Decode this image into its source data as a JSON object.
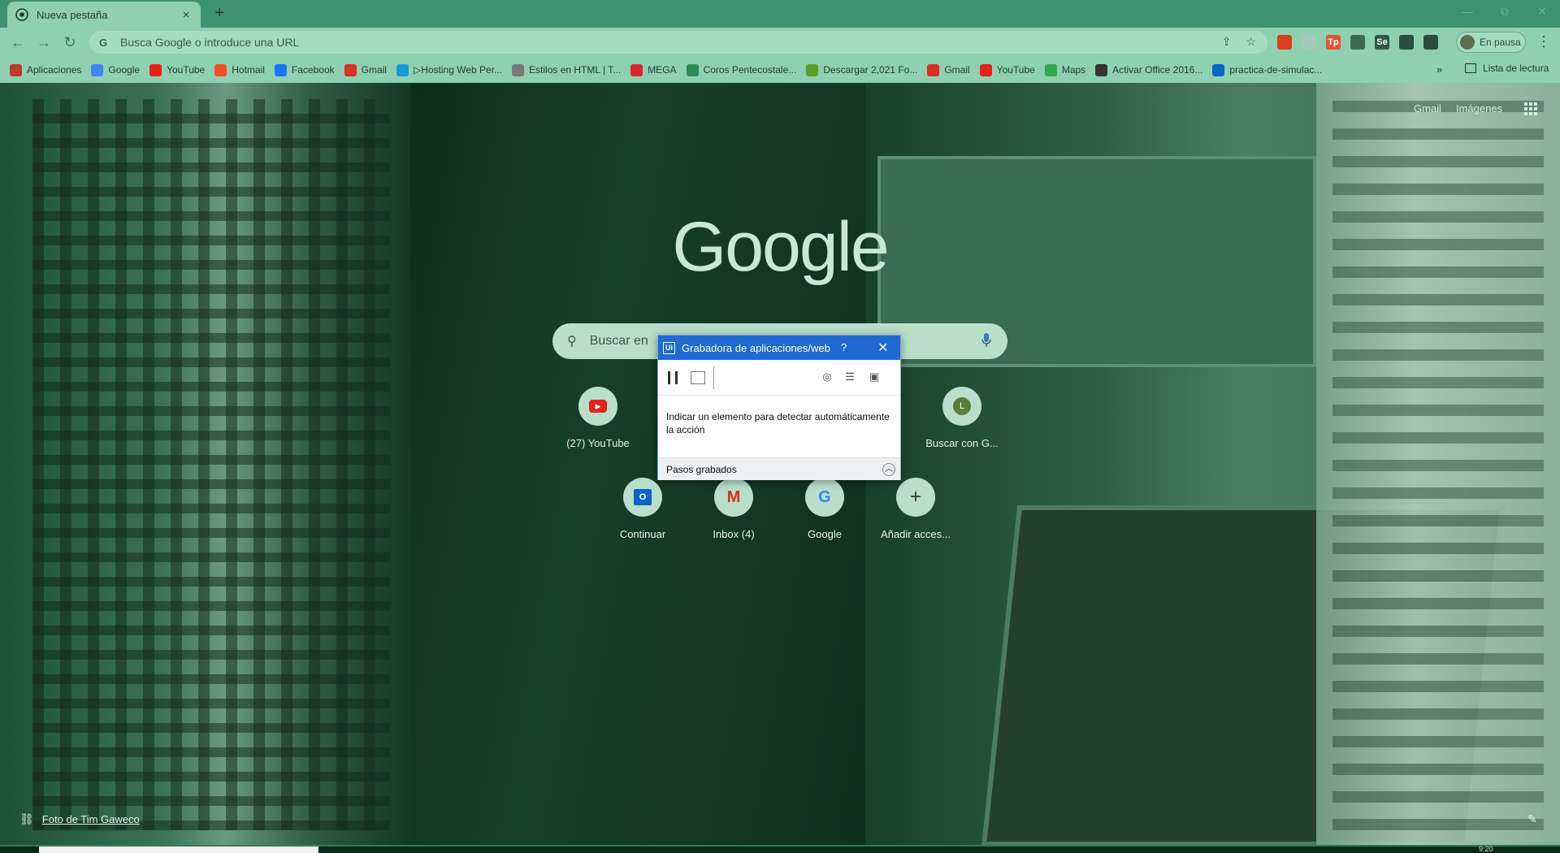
{
  "browser": {
    "tab_title": "Nueva pestaña",
    "tab_close": "×",
    "new_tab": "+",
    "window_controls": [
      "—",
      "⧉",
      "✕"
    ],
    "address_placeholder": "Busca Google o introduce una URL",
    "profile_label": "En pausa",
    "menu": "⋮"
  },
  "extensions": [
    {
      "label": "",
      "color": "#d8401f"
    },
    {
      "label": "",
      "color": "#a7c8b8"
    },
    {
      "label": "Tp",
      "color": "#e55332"
    },
    {
      "label": "",
      "color": "#3c6b53"
    },
    {
      "label": "Se",
      "color": "#2f5848"
    },
    {
      "label": "",
      "color": "#2b4d40"
    },
    {
      "label": "",
      "color": "#2b4d40"
    }
  ],
  "bookmarks": [
    {
      "label": "Aplicaciones",
      "icon": "apps-grid-icon",
      "color": "#c0392b"
    },
    {
      "label": "Google",
      "icon": "google-icon",
      "color": "#4285f4"
    },
    {
      "label": "YouTube",
      "icon": "youtube-icon",
      "color": "#e62117"
    },
    {
      "label": "Hotmail",
      "icon": "hotmail-icon",
      "color": "#f25022"
    },
    {
      "label": "Facebook",
      "icon": "facebook-icon",
      "color": "#1877f2"
    },
    {
      "label": "Gmail",
      "icon": "gmail-icon",
      "color": "#d93025"
    },
    {
      "label": "▷Hosting Web Per...",
      "icon": "hosting-icon",
      "color": "#1a9bd8"
    },
    {
      "label": "Estilos en HTML | T...",
      "icon": "doc-icon",
      "color": "#7a7a7a"
    },
    {
      "label": "MEGA",
      "icon": "mega-icon",
      "color": "#d9272e"
    },
    {
      "label": "Coros Pentecostale...",
      "icon": "coros-icon",
      "color": "#2e8b57"
    },
    {
      "label": "Descargar 2,021 Fo...",
      "icon": "leaf-icon",
      "color": "#5aa02c"
    },
    {
      "label": "Gmail",
      "icon": "gmail-icon",
      "color": "#d93025"
    },
    {
      "label": "YouTube",
      "icon": "youtube-icon",
      "color": "#e62117"
    },
    {
      "label": "Maps",
      "icon": "maps-icon",
      "color": "#34a853"
    },
    {
      "label": "Activar Office 2016...",
      "icon": "office-icon",
      "color": "#333333"
    },
    {
      "label": "practica-de-simulac...",
      "icon": "linkedin-icon",
      "color": "#0a66c2"
    }
  ],
  "bookmarks_more": "»",
  "reading_list": "Lista de lectura",
  "ntp": {
    "top_links": [
      "Gmail",
      "Imágenes"
    ],
    "logo": "Google",
    "search_placeholder": "Buscar en",
    "shortcuts_row1": [
      {
        "label": "(27) YouTube",
        "icon": "youtube-icon",
        "glyph": "▶",
        "color": "#e62117"
      },
      {
        "label": "Buscar con G...",
        "icon": "avatar-l-icon",
        "glyph": "L",
        "color": "#5b7d3a"
      }
    ],
    "shortcuts_row2": [
      {
        "label": "Continuar",
        "icon": "outlook-icon",
        "glyph": "O",
        "color": "#0a64c8"
      },
      {
        "label": "Inbox (4)",
        "icon": "gmail-icon",
        "glyph": "M",
        "color": "#d93025"
      },
      {
        "label": "Google",
        "icon": "google-icon",
        "glyph": "G",
        "color": "#4285f4"
      },
      {
        "label": "Añadir acces...",
        "icon": "add-icon",
        "glyph": "+",
        "color": "#333333"
      }
    ],
    "photo_credit": "Foto de Tim Gaweco",
    "edit": "✎"
  },
  "recorder": {
    "title": "Grabadora de aplicaciones/web",
    "help": "?",
    "close": "✕",
    "message": "Indicar un elemento para detectar automáticamente la acción",
    "steps_label": "Pasos grabados",
    "steps_toggle": "︿"
  },
  "taskbar": {
    "time": "9:20"
  }
}
